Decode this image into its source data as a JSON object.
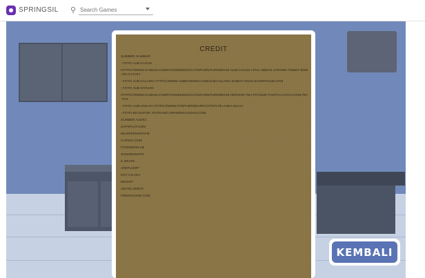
{
  "toolbar": {
    "brand": "SPRINGSIL",
    "search_placeholder": "Search Games"
  },
  "credit": {
    "title": "CREDIT",
    "items": [
      "SUMBER GAMBAR:",
      "- FOTO AUB KAGUS",
      "HTTPS://WWW.ICABIAN.COM/FOOD/BSEDO/CUTE/FURNITURE/B0AM-AUB-CAGUS-I-PAU-ABBAN-JAPANIN-TWEET-0045-AR-CV-ICEY",
      "- FOTO AUB KALANG HTTPS://WWW.ASBRANDON.COM/AUB-CALANG-OUBAT-ADAN-SHARPANABI.HTM",
      "- FOTO AUB SATUAN",
      "HTTPS://WWW.ICABIAN.COM/FOOD/BSEDO/CUTE/FURNITURE/B0AM-HERSON-TEA-POTSUE-TOOTH-CATCH-ICON-PIC-TAIL",
      "- FOTO AUB LINCAH HTTPS://WWW.STEPHEN/B0ARPLOT/STATE-AUB-LINCAH",
      "- FOTO BG DAPUR: RUTDANG DRAWINGASSIAN.COM",
      "SUMBER AUDIO:",
      "ZAPSPLAT.COM",
      "MUSOPENGRAFIK",
      "CAPSIO.COM",
      "FOODWARLAB",
      "SOUNDSNAPS",
      "K DRATE",
      "ARDTLOOP",
      "KOT CILAKA",
      "MOOOT",
      "ABYSS ARRAY",
      "FREESOUND.COM"
    ]
  },
  "buttons": {
    "back_label": "KEMBALI"
  },
  "colors": {
    "panel": "#8b7647",
    "button": "#5973b5",
    "wall": "#7189ba"
  }
}
